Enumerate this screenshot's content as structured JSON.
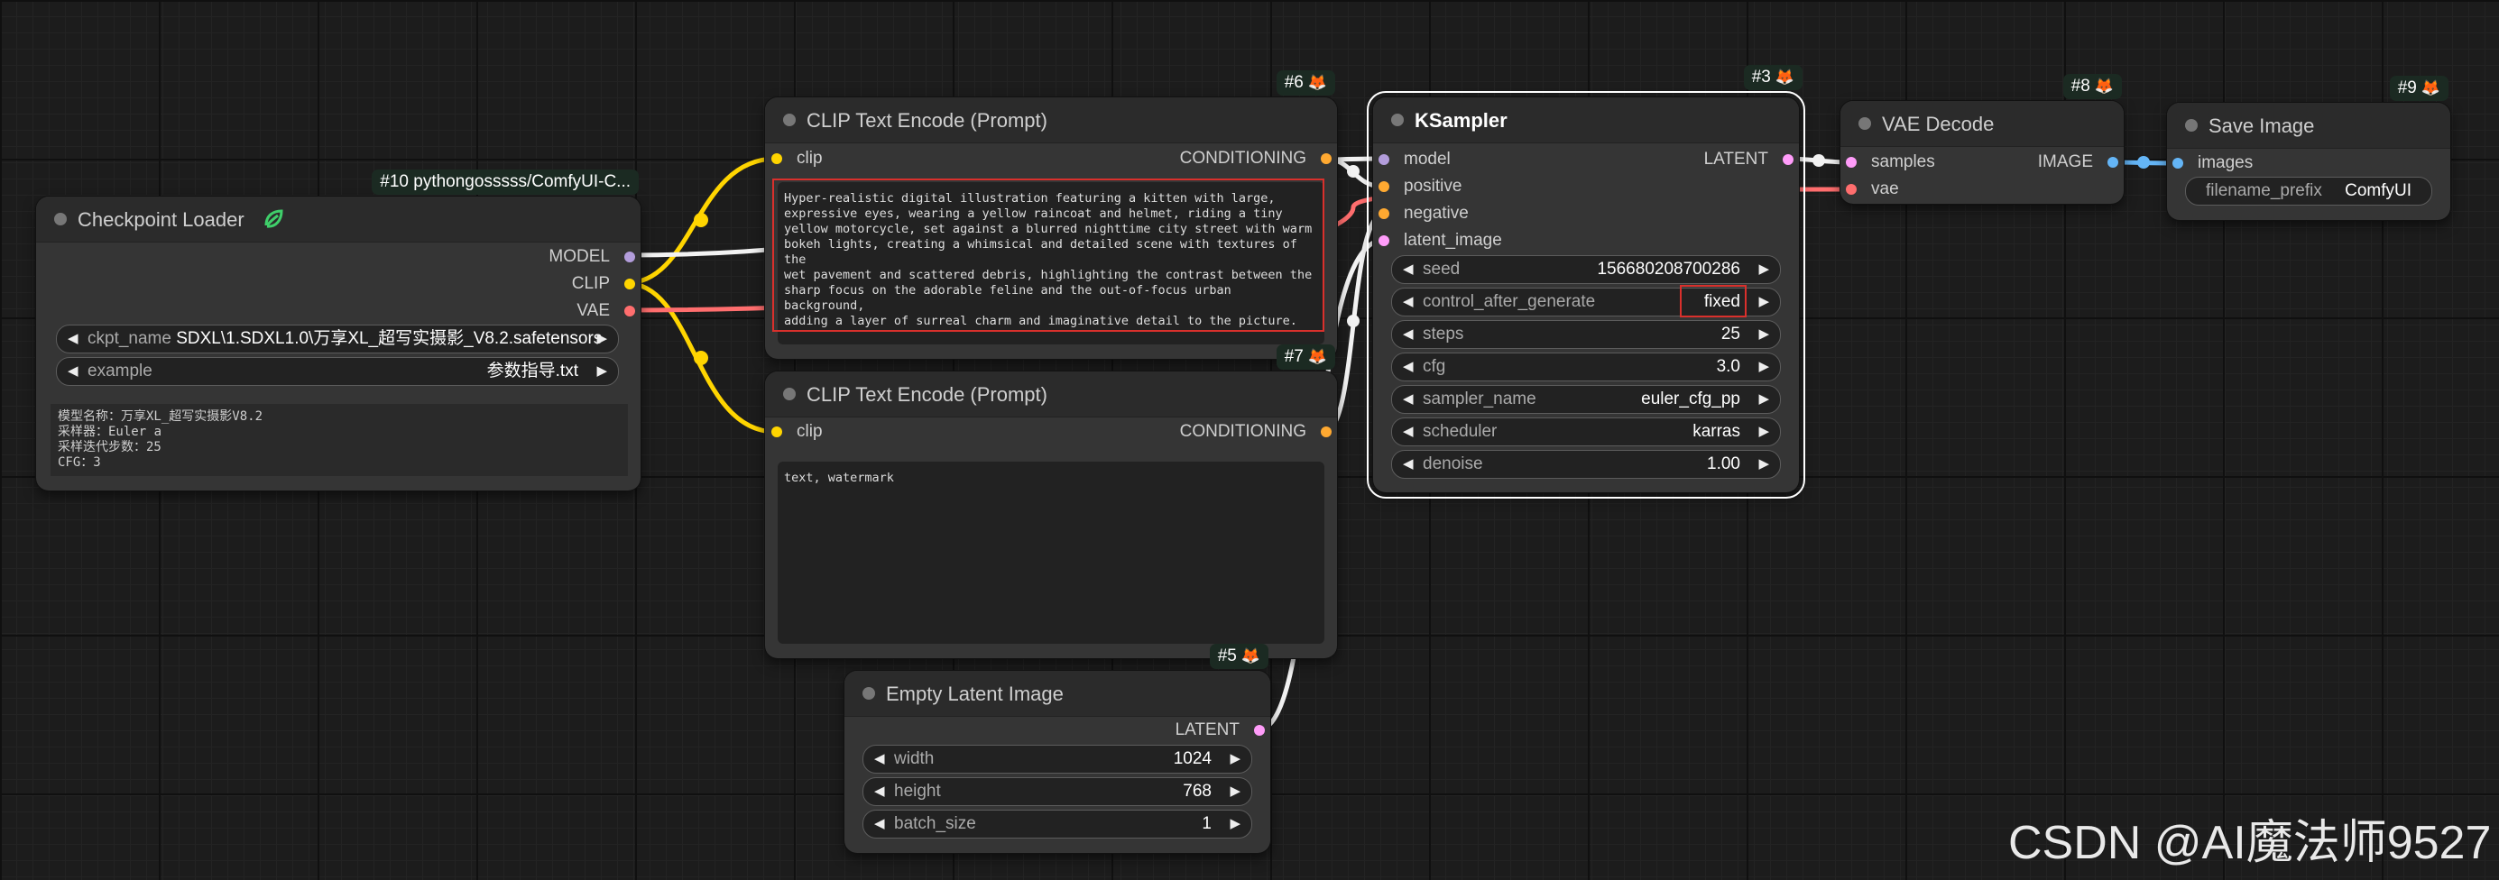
{
  "colors": {
    "model": "#b39ddb",
    "clip": "#ffd500",
    "vae": "#ff6e6e",
    "conditioning": "#ffa931",
    "latent": "#ff9cf9",
    "image": "#64b5f6"
  },
  "checkpoint": {
    "badge": "#10 pythongosssss/ComfyUI-C...",
    "title": "Checkpoint Loader",
    "outputs": [
      "MODEL",
      "CLIP",
      "VAE"
    ],
    "ckpt_label": "ckpt_name",
    "ckpt_value": "SDXL\\1.SDXL1.0\\万享XL_超写实摄影_V8.2.safetensors",
    "example_label": "example",
    "example_value": "参数指导.txt",
    "info": "模型名称：万享XL_超写实摄影V8.2\n采样器：Euler a\n采样迭代步数：25\nCFG：3"
  },
  "clip_pos": {
    "badge": "#6",
    "title": "CLIP Text Encode (Prompt)",
    "input": "clip",
    "output": "CONDITIONING",
    "text": "Hyper-realistic digital illustration featuring a kitten with large,\nexpressive eyes, wearing a yellow raincoat and helmet, riding a tiny\nyellow motorcycle, set against a blurred nighttime city street with warm\nbokeh lights, creating a whimsical and detailed scene with textures of the\nwet pavement and scattered debris, highlighting the contrast between the\nsharp focus on the adorable feline and the out-of-focus urban background,\nadding a layer of surreal charm and imaginative detail to the picture."
  },
  "clip_neg": {
    "badge": "#7",
    "title": "CLIP Text Encode (Prompt)",
    "input": "clip",
    "output": "CONDITIONING",
    "text": "text, watermark"
  },
  "empty_latent": {
    "badge": "#5",
    "title": "Empty Latent Image",
    "output": "LATENT",
    "widgets": [
      {
        "label": "width",
        "value": "1024"
      },
      {
        "label": "height",
        "value": "768"
      },
      {
        "label": "batch_size",
        "value": "1"
      }
    ]
  },
  "ksampler": {
    "badge": "#3",
    "title": "KSampler",
    "inputs": [
      "model",
      "positive",
      "negative",
      "latent_image"
    ],
    "output": "LATENT",
    "widgets": [
      {
        "label": "seed",
        "value": "156680208700286"
      },
      {
        "label": "control_after_generate",
        "value": "fixed"
      },
      {
        "label": "steps",
        "value": "25"
      },
      {
        "label": "cfg",
        "value": "3.0"
      },
      {
        "label": "sampler_name",
        "value": "euler_cfg_pp"
      },
      {
        "label": "scheduler",
        "value": "karras"
      },
      {
        "label": "denoise",
        "value": "1.00"
      }
    ]
  },
  "vae_decode": {
    "badge": "#8",
    "title": "VAE Decode",
    "inputs": [
      "samples",
      "vae"
    ],
    "output": "IMAGE"
  },
  "save_image": {
    "badge": "#9",
    "title": "Save Image",
    "input": "images",
    "prefix_label": "filename_prefix",
    "prefix_value": "ComfyUI"
  },
  "watermark": "CSDN @AI魔法师9527"
}
